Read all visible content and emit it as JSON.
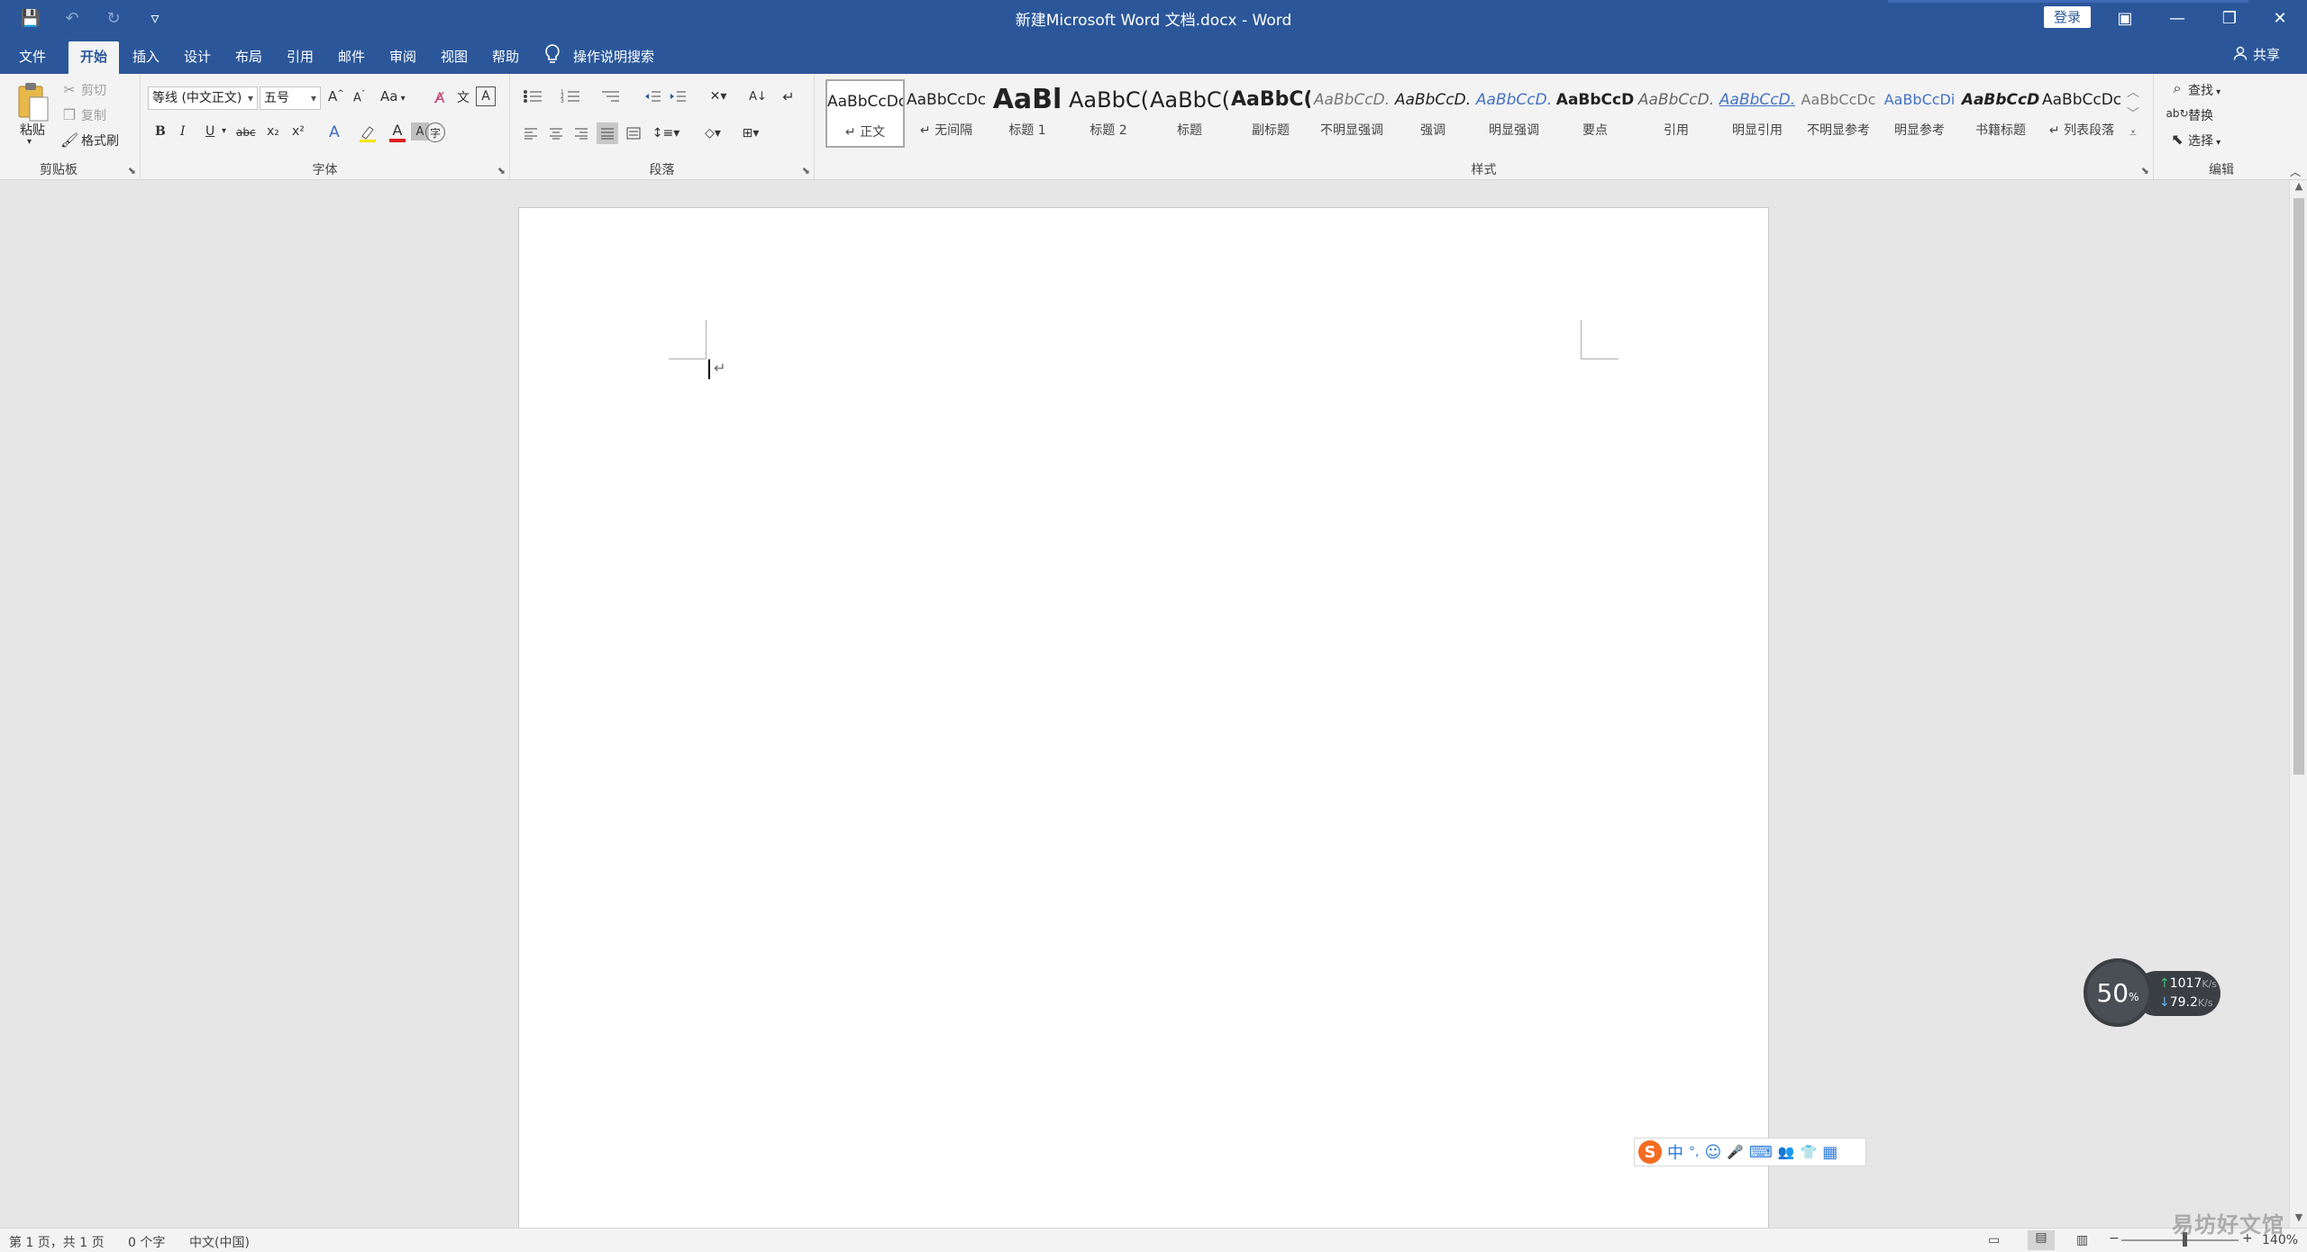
{
  "window": {
    "title": "新建Microsoft Word 文档.docx  -  Word",
    "login": "登录",
    "controls": {
      "ribbon_display": "▣",
      "minimize": "—",
      "restore": "❐",
      "close": "✕"
    }
  },
  "qat": {
    "save_icon": "💾",
    "undo_icon": "↶",
    "redo_icon": "↻",
    "customize_icon": "▿"
  },
  "tabs": [
    {
      "label": "文件"
    },
    {
      "label": "开始"
    },
    {
      "label": "插入"
    },
    {
      "label": "设计"
    },
    {
      "label": "布局"
    },
    {
      "label": "引用"
    },
    {
      "label": "邮件"
    },
    {
      "label": "审阅"
    },
    {
      "label": "视图"
    },
    {
      "label": "帮助"
    }
  ],
  "tell_me": "操作说明搜索",
  "share": "共享",
  "clipboard": {
    "label": "剪贴板",
    "paste": "粘贴",
    "cut": "剪切",
    "copy": "复制",
    "format_painter": "格式刷"
  },
  "font": {
    "label": "字体",
    "family": "等线 (中文正文)",
    "size": "五号",
    "grow": "A",
    "shrink": "A",
    "case": "Aa",
    "bold": "B",
    "italic": "I",
    "underline": "U",
    "strike": "abc",
    "subscript": "x₂",
    "superscript": "x²",
    "font_color": "A",
    "shading": "A"
  },
  "paragraph": {
    "label": "段落"
  },
  "styles": {
    "label": "样式",
    "items": [
      {
        "sample": "AaBbCcDc",
        "name": "↵ 正文"
      },
      {
        "sample": "AaBbCcDc",
        "name": "↵ 无间隔"
      },
      {
        "sample": "AaBl",
        "name": "标题 1"
      },
      {
        "sample": "AaBbC(",
        "name": "标题 2"
      },
      {
        "sample": "AaBbC(",
        "name": "标题"
      },
      {
        "sample": "AaBbC(",
        "name": "副标题"
      },
      {
        "sample": "AaBbCcD.",
        "name": "不明显强调"
      },
      {
        "sample": "AaBbCcD.",
        "name": "强调"
      },
      {
        "sample": "AaBbCcD.",
        "name": "明显强调"
      },
      {
        "sample": "AaBbCcD",
        "name": "要点"
      },
      {
        "sample": "AaBbCcD.",
        "name": "引用"
      },
      {
        "sample": "AaBbCcD.",
        "name": "明显引用"
      },
      {
        "sample": "AaBbCcDc",
        "name": "不明显参考"
      },
      {
        "sample": "AaBbCcDi",
        "name": "明显参考"
      },
      {
        "sample": "AaBbCcD",
        "name": "书籍标题"
      },
      {
        "sample": "AaBbCcDc",
        "name": "↵ 列表段落"
      }
    ]
  },
  "editing": {
    "label": "编辑",
    "find": "查找",
    "replace": "替换",
    "select": "选择"
  },
  "document": {
    "paragraph_mark": "↵"
  },
  "network": {
    "percent": "50",
    "percent_unit": "%",
    "up": "1017",
    "down": "79.2",
    "unit": "K/s"
  },
  "ime": {
    "logo": "S",
    "mode": "中",
    "punct": "°,",
    "items": [
      "☺",
      "🎤",
      "⌨",
      "👥",
      "👕",
      "▦"
    ]
  },
  "status": {
    "page": "第 1 页，共 1 页",
    "words": "0 个字",
    "language": "中文(中国)",
    "zoom_minus": "−",
    "zoom_plus": "+",
    "zoom": "140%"
  },
  "watermark": "易坊好文馆"
}
